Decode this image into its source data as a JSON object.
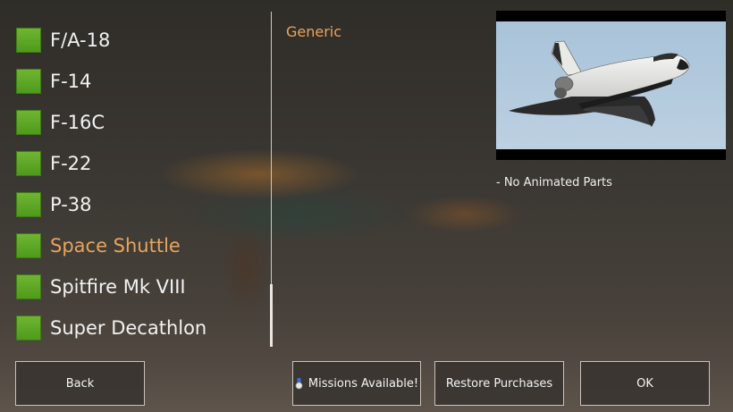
{
  "aircraft_list": {
    "items": [
      {
        "label": "F/A-18",
        "selected": false
      },
      {
        "label": "F-14",
        "selected": false
      },
      {
        "label": "F-16C",
        "selected": false
      },
      {
        "label": "F-22",
        "selected": false
      },
      {
        "label": "P-38",
        "selected": false
      },
      {
        "label": "Space Shuttle",
        "selected": true
      },
      {
        "label": "Spitfire Mk VIII",
        "selected": false
      },
      {
        "label": "Super Decathlon",
        "selected": false
      }
    ]
  },
  "detail": {
    "category": "Generic",
    "note": "- No Animated Parts"
  },
  "footer": {
    "back_label": "Back",
    "missions_label": "Missions Available!",
    "restore_label": "Restore Purchases",
    "ok_label": "OK"
  },
  "colors": {
    "checkbox_green": "#5aa524",
    "selected_text": "#e9a45c",
    "sky": "#a9c3d9"
  },
  "icons": {
    "missions": "medal-icon"
  }
}
